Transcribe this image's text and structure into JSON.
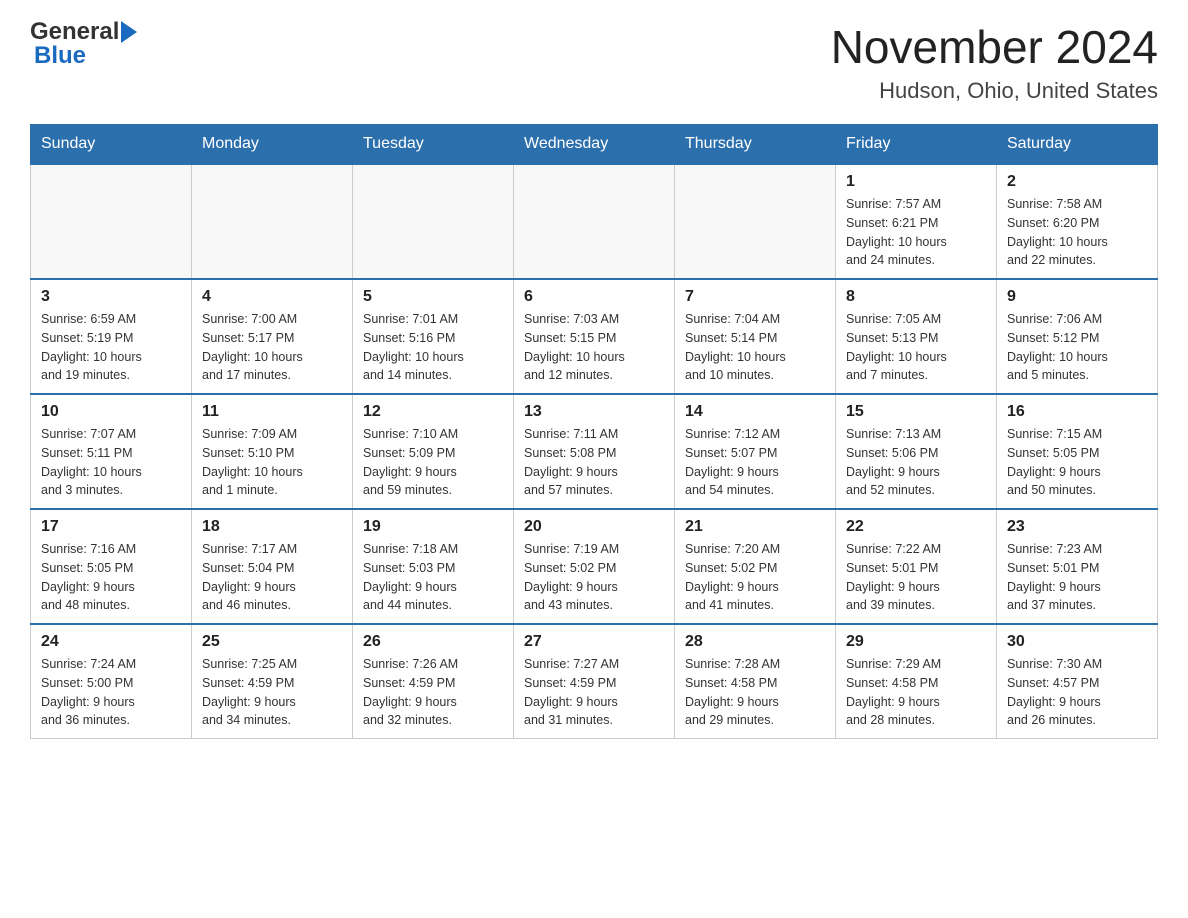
{
  "header": {
    "logo_general": "General",
    "logo_blue": "Blue",
    "month_title": "November 2024",
    "location": "Hudson, Ohio, United States"
  },
  "days_of_week": [
    "Sunday",
    "Monday",
    "Tuesday",
    "Wednesday",
    "Thursday",
    "Friday",
    "Saturday"
  ],
  "weeks": [
    {
      "days": [
        {
          "num": "",
          "info": ""
        },
        {
          "num": "",
          "info": ""
        },
        {
          "num": "",
          "info": ""
        },
        {
          "num": "",
          "info": ""
        },
        {
          "num": "",
          "info": ""
        },
        {
          "num": "1",
          "info": "Sunrise: 7:57 AM\nSunset: 6:21 PM\nDaylight: 10 hours\nand 24 minutes."
        },
        {
          "num": "2",
          "info": "Sunrise: 7:58 AM\nSunset: 6:20 PM\nDaylight: 10 hours\nand 22 minutes."
        }
      ]
    },
    {
      "days": [
        {
          "num": "3",
          "info": "Sunrise: 6:59 AM\nSunset: 5:19 PM\nDaylight: 10 hours\nand 19 minutes."
        },
        {
          "num": "4",
          "info": "Sunrise: 7:00 AM\nSunset: 5:17 PM\nDaylight: 10 hours\nand 17 minutes."
        },
        {
          "num": "5",
          "info": "Sunrise: 7:01 AM\nSunset: 5:16 PM\nDaylight: 10 hours\nand 14 minutes."
        },
        {
          "num": "6",
          "info": "Sunrise: 7:03 AM\nSunset: 5:15 PM\nDaylight: 10 hours\nand 12 minutes."
        },
        {
          "num": "7",
          "info": "Sunrise: 7:04 AM\nSunset: 5:14 PM\nDaylight: 10 hours\nand 10 minutes."
        },
        {
          "num": "8",
          "info": "Sunrise: 7:05 AM\nSunset: 5:13 PM\nDaylight: 10 hours\nand 7 minutes."
        },
        {
          "num": "9",
          "info": "Sunrise: 7:06 AM\nSunset: 5:12 PM\nDaylight: 10 hours\nand 5 minutes."
        }
      ]
    },
    {
      "days": [
        {
          "num": "10",
          "info": "Sunrise: 7:07 AM\nSunset: 5:11 PM\nDaylight: 10 hours\nand 3 minutes."
        },
        {
          "num": "11",
          "info": "Sunrise: 7:09 AM\nSunset: 5:10 PM\nDaylight: 10 hours\nand 1 minute."
        },
        {
          "num": "12",
          "info": "Sunrise: 7:10 AM\nSunset: 5:09 PM\nDaylight: 9 hours\nand 59 minutes."
        },
        {
          "num": "13",
          "info": "Sunrise: 7:11 AM\nSunset: 5:08 PM\nDaylight: 9 hours\nand 57 minutes."
        },
        {
          "num": "14",
          "info": "Sunrise: 7:12 AM\nSunset: 5:07 PM\nDaylight: 9 hours\nand 54 minutes."
        },
        {
          "num": "15",
          "info": "Sunrise: 7:13 AM\nSunset: 5:06 PM\nDaylight: 9 hours\nand 52 minutes."
        },
        {
          "num": "16",
          "info": "Sunrise: 7:15 AM\nSunset: 5:05 PM\nDaylight: 9 hours\nand 50 minutes."
        }
      ]
    },
    {
      "days": [
        {
          "num": "17",
          "info": "Sunrise: 7:16 AM\nSunset: 5:05 PM\nDaylight: 9 hours\nand 48 minutes."
        },
        {
          "num": "18",
          "info": "Sunrise: 7:17 AM\nSunset: 5:04 PM\nDaylight: 9 hours\nand 46 minutes."
        },
        {
          "num": "19",
          "info": "Sunrise: 7:18 AM\nSunset: 5:03 PM\nDaylight: 9 hours\nand 44 minutes."
        },
        {
          "num": "20",
          "info": "Sunrise: 7:19 AM\nSunset: 5:02 PM\nDaylight: 9 hours\nand 43 minutes."
        },
        {
          "num": "21",
          "info": "Sunrise: 7:20 AM\nSunset: 5:02 PM\nDaylight: 9 hours\nand 41 minutes."
        },
        {
          "num": "22",
          "info": "Sunrise: 7:22 AM\nSunset: 5:01 PM\nDaylight: 9 hours\nand 39 minutes."
        },
        {
          "num": "23",
          "info": "Sunrise: 7:23 AM\nSunset: 5:01 PM\nDaylight: 9 hours\nand 37 minutes."
        }
      ]
    },
    {
      "days": [
        {
          "num": "24",
          "info": "Sunrise: 7:24 AM\nSunset: 5:00 PM\nDaylight: 9 hours\nand 36 minutes."
        },
        {
          "num": "25",
          "info": "Sunrise: 7:25 AM\nSunset: 4:59 PM\nDaylight: 9 hours\nand 34 minutes."
        },
        {
          "num": "26",
          "info": "Sunrise: 7:26 AM\nSunset: 4:59 PM\nDaylight: 9 hours\nand 32 minutes."
        },
        {
          "num": "27",
          "info": "Sunrise: 7:27 AM\nSunset: 4:59 PM\nDaylight: 9 hours\nand 31 minutes."
        },
        {
          "num": "28",
          "info": "Sunrise: 7:28 AM\nSunset: 4:58 PM\nDaylight: 9 hours\nand 29 minutes."
        },
        {
          "num": "29",
          "info": "Sunrise: 7:29 AM\nSunset: 4:58 PM\nDaylight: 9 hours\nand 28 minutes."
        },
        {
          "num": "30",
          "info": "Sunrise: 7:30 AM\nSunset: 4:57 PM\nDaylight: 9 hours\nand 26 minutes."
        }
      ]
    }
  ]
}
